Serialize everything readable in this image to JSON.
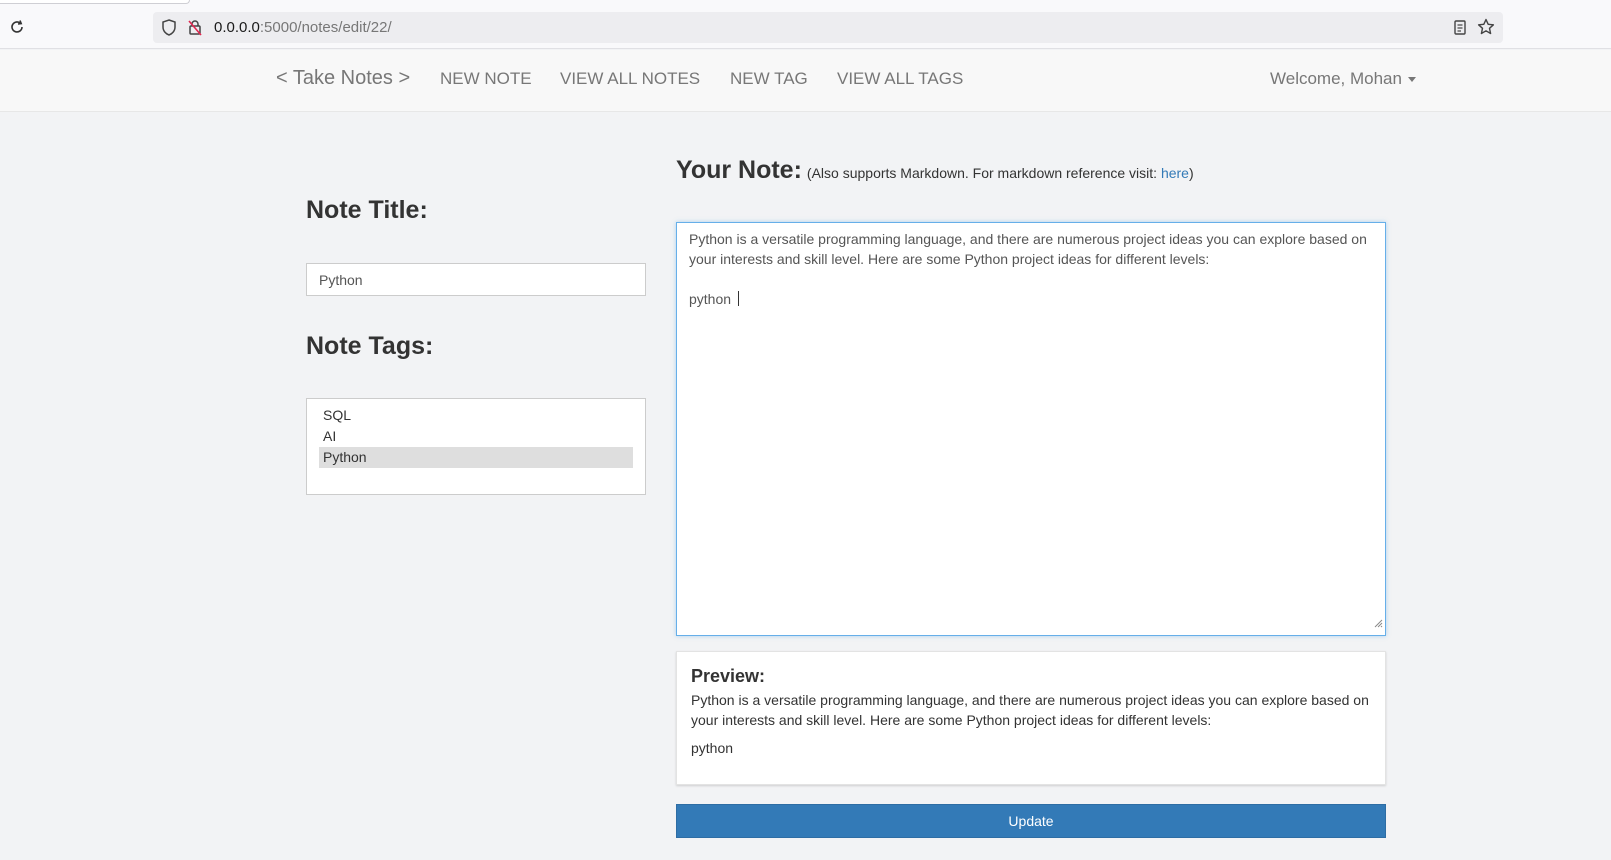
{
  "browser": {
    "url_host": "0.0.0.0",
    "url_path": ":5000/notes/edit/22/"
  },
  "navbar": {
    "brand": "< Take Notes >",
    "links": [
      "NEW NOTE",
      "VIEW ALL NOTES",
      "NEW TAG",
      "VIEW ALL TAGS"
    ],
    "welcome": "Welcome, Mohan"
  },
  "form": {
    "title_label": "Note Title:",
    "title_value": "Python",
    "tags_label": "Note Tags:",
    "tags": [
      {
        "label": "SQL",
        "selected": false
      },
      {
        "label": "AI",
        "selected": false
      },
      {
        "label": "Python",
        "selected": true
      }
    ],
    "note_label": "Your Note:",
    "note_hint_prefix": "(Also supports Markdown. For markdown reference visit: ",
    "note_hint_link": "here",
    "note_hint_suffix": ")",
    "note_text_line1": "Python is a versatile programming language, and there are numerous project ideas you can explore based on your interests and skill level. Here are some Python project ideas for different levels:",
    "note_text_line2": "python ",
    "update_label": "Update"
  },
  "preview": {
    "title": "Preview:",
    "paragraph1": "Python is a versatile programming language, and there are numerous project ideas you can explore based on your interests and skill level. Here are some Python project ideas for different levels:",
    "paragraph2": "python"
  },
  "colors": {
    "primary": "#337ab7",
    "link": "#337ab7",
    "page_bg": "#f2f3f5"
  }
}
